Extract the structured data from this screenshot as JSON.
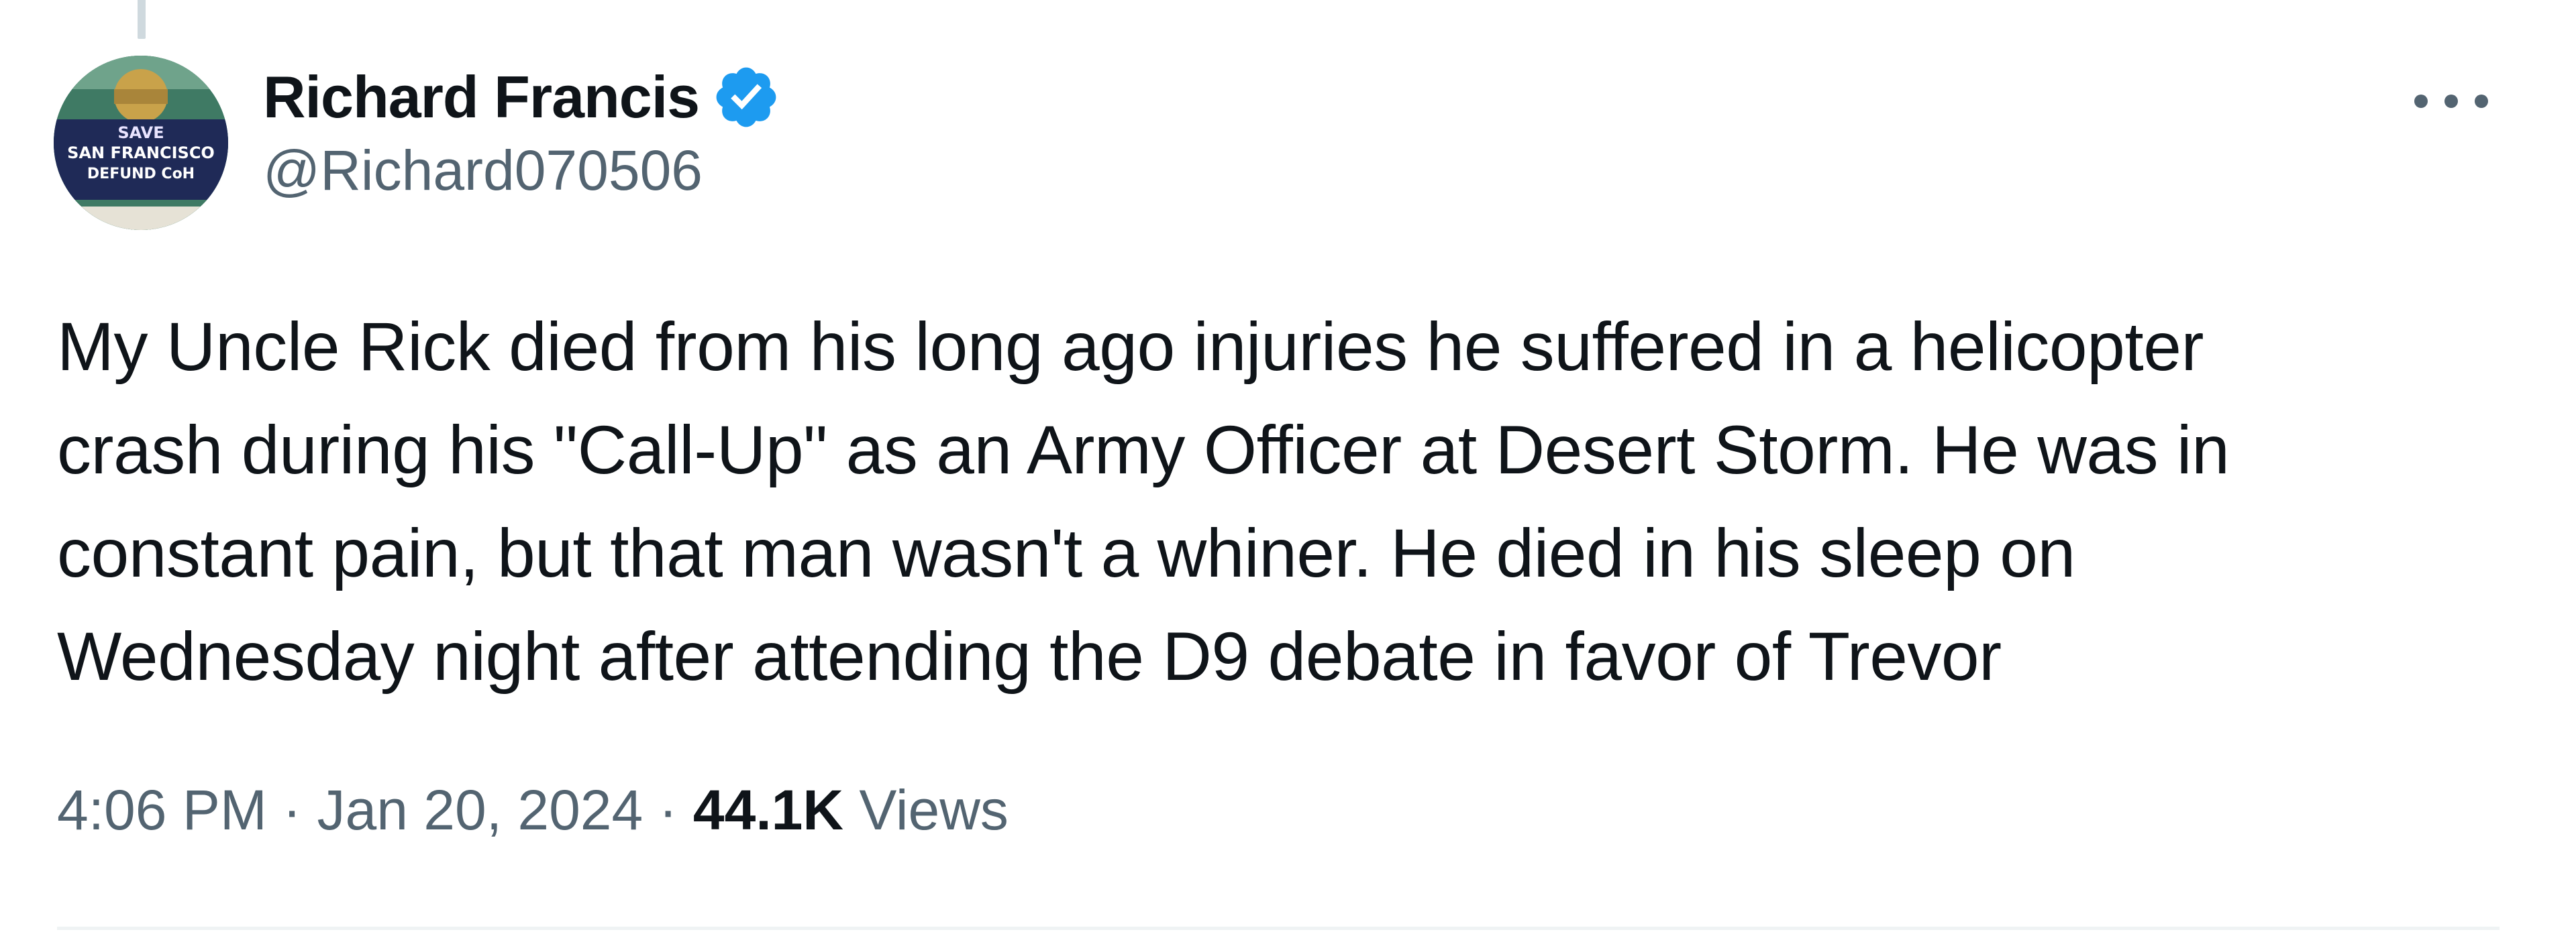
{
  "author": {
    "name": "Richard Francis",
    "handle": "@Richard070506",
    "verified": true,
    "avatar": {
      "icon": "profile-avatar",
      "sign_lines": [
        "SAVE",
        "SAN FRANCISCO",
        "DEFUND CoH"
      ]
    }
  },
  "menu": {
    "icon": "more-options-icon"
  },
  "tweet": {
    "lines": [
      "My Uncle Rick died from his long ago injuries he suffered in a helicopter",
      "crash during his \"Call-Up\" as an Army Officer at Desert Storm. He was in",
      "constant pain, but that man wasn't a whiner. He died in his sleep on",
      "Wednesday night after attending the D9 debate in favor of Trevor"
    ]
  },
  "meta": {
    "time": "4:06 PM",
    "separator": " · ",
    "date": "Jan 20, 2024",
    "views_count": "44.1K",
    "views_label": " Views"
  },
  "colors": {
    "verified_badge": "#1d9bf0",
    "text_primary": "#0f1419",
    "text_secondary": "#536471",
    "divider": "#eff3f4"
  }
}
